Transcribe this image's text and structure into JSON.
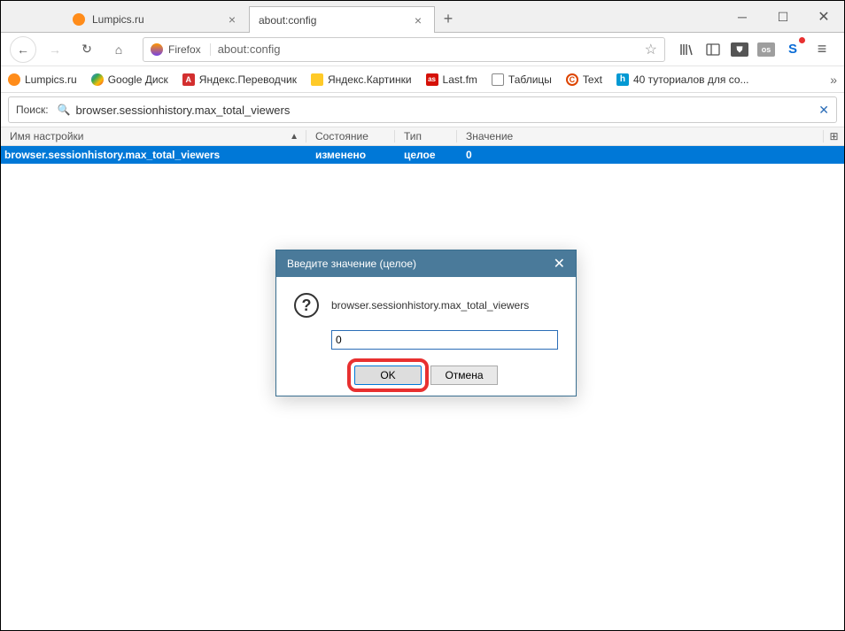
{
  "tabs": [
    {
      "label": "Lumpics.ru"
    },
    {
      "label": "about:config"
    }
  ],
  "address": {
    "product": "Firefox",
    "url": "about:config"
  },
  "bookmarks": [
    {
      "label": "Lumpics.ru"
    },
    {
      "label": "Google Диск"
    },
    {
      "label": "Яндекс.Переводчик"
    },
    {
      "label": "Яндекс.Картинки"
    },
    {
      "label": "Last.fm"
    },
    {
      "label": "Таблицы"
    },
    {
      "label": "Text"
    },
    {
      "label": "40 туториалов для со..."
    }
  ],
  "search": {
    "label": "Поиск:",
    "value": "browser.sessionhistory.max_total_viewers"
  },
  "columns": {
    "name": "Имя настройки",
    "state": "Состояние",
    "type": "Тип",
    "value": "Значение"
  },
  "row": {
    "name": "browser.sessionhistory.max_total_viewers",
    "state": "изменено",
    "type": "целое",
    "value": "0"
  },
  "dialog": {
    "title": "Введите значение (целое)",
    "label": "browser.sessionhistory.max_total_viewers",
    "input": "0",
    "ok": "OK",
    "cancel": "Отмена"
  }
}
